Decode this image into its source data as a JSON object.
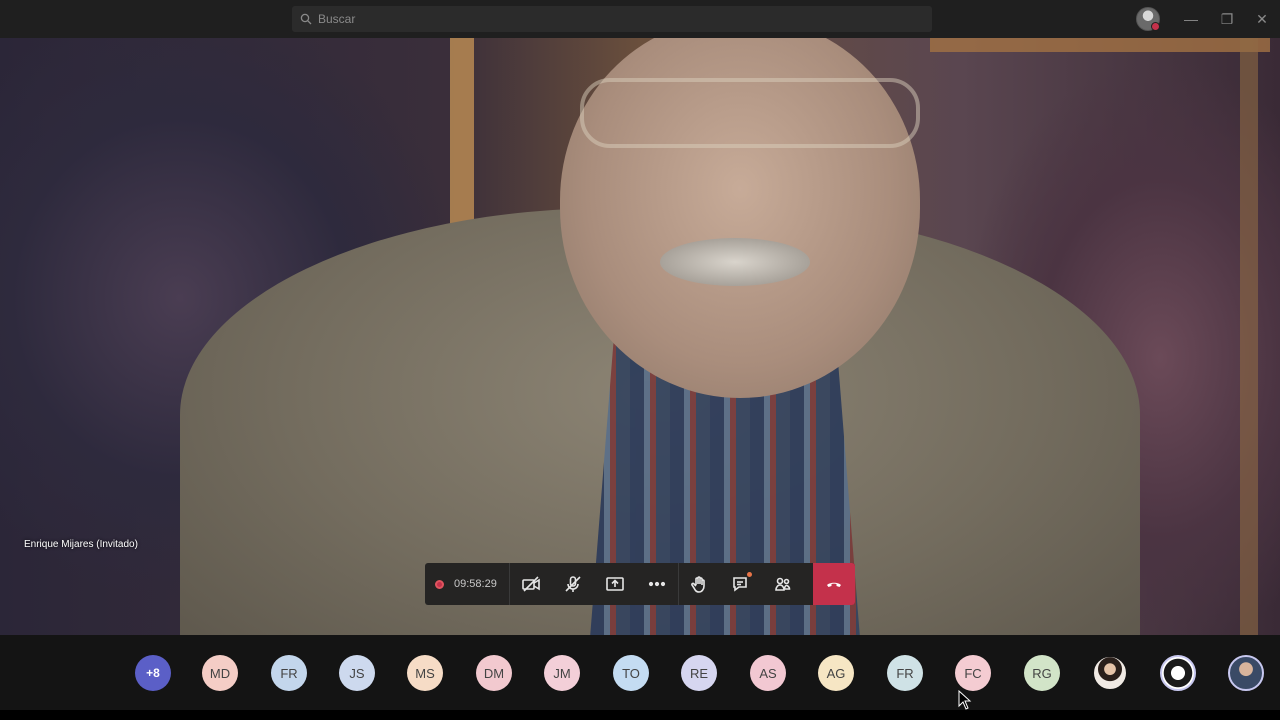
{
  "search": {
    "placeholder": "Buscar"
  },
  "window_controls": {
    "minimize": "—",
    "restore": "❐",
    "close": "✕"
  },
  "video": {
    "speaker_name": "Enrique Mijares (Invitado)"
  },
  "call": {
    "duration": "09:58:29",
    "controls": [
      {
        "name": "camera-off",
        "icon": "camera-off-icon"
      },
      {
        "name": "mic-off",
        "icon": "mic-off-icon"
      },
      {
        "name": "share-screen",
        "icon": "share-icon"
      },
      {
        "name": "more-actions",
        "icon": "ellipsis-icon"
      },
      {
        "name": "raise-hand",
        "icon": "hand-icon"
      },
      {
        "name": "chat",
        "icon": "chat-icon"
      },
      {
        "name": "participants",
        "icon": "people-icon"
      },
      {
        "name": "hang-up",
        "icon": "phone-hangup-icon"
      }
    ],
    "colors": {
      "hangup": "#c4314b",
      "record": "#c4314b",
      "more_badge": "#5b5fc7"
    }
  },
  "participants": {
    "overflow_count": "+8",
    "initials": [
      {
        "label": "MD",
        "color": "#f4cdc6"
      },
      {
        "label": "FR",
        "color": "#c3d6ec"
      },
      {
        "label": "JS",
        "color": "#cdd9ee"
      },
      {
        "label": "MS",
        "color": "#f6dcc6"
      },
      {
        "label": "DM",
        "color": "#f2c9cf"
      },
      {
        "label": "JM",
        "color": "#f3cfd8"
      },
      {
        "label": "TO",
        "color": "#c4dcf2"
      },
      {
        "label": "RE",
        "color": "#d6d6f0"
      },
      {
        "label": "AS",
        "color": "#f2c8d2"
      },
      {
        "label": "AG",
        "color": "#f6e6c4"
      },
      {
        "label": "FR",
        "color": "#cfe2e6"
      },
      {
        "label": "FC",
        "color": "#f4ccd2"
      },
      {
        "label": "RG",
        "color": "#d2e4c8"
      }
    ]
  }
}
